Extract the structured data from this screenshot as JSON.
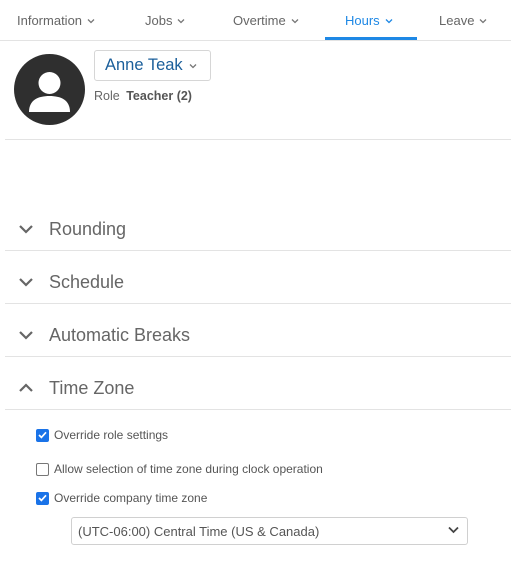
{
  "colors": {
    "accent": "#1e88e5",
    "name": "#1a5e9a",
    "checkbox": "#1a73e8",
    "avatar_bg": "#2f2f2f"
  },
  "tabs": [
    {
      "label": "Information",
      "active": false
    },
    {
      "label": "Jobs",
      "active": false
    },
    {
      "label": "Overtime",
      "active": false
    },
    {
      "label": "Hours",
      "active": true
    },
    {
      "label": "Leave",
      "active": false
    }
  ],
  "profile": {
    "avatar_icon": "user-avatar-icon",
    "name": "Anne Teak",
    "role_label": "Role",
    "role_value": "Teacher (2)"
  },
  "sections": [
    {
      "title": "Rounding",
      "expanded": false
    },
    {
      "title": "Schedule",
      "expanded": false
    },
    {
      "title": "Automatic Breaks",
      "expanded": false
    },
    {
      "title": "Time Zone",
      "expanded": true
    }
  ],
  "time_zone": {
    "override_role": {
      "label": "Override role settings",
      "checked": true
    },
    "allow_selection": {
      "label": "Allow selection of time zone during clock operation",
      "checked": false
    },
    "override_company": {
      "label": "Override company time zone",
      "checked": true
    },
    "selected_zone": "(UTC-06:00) Central Time (US & Canada)"
  }
}
